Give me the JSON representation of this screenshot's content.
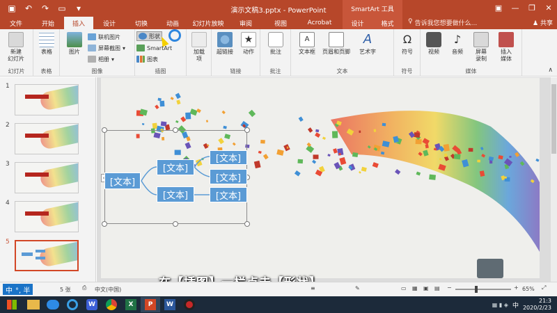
{
  "window": {
    "title": "演示文稿3.pptx - PowerPoint",
    "context_title": "SmartArt 工具",
    "controls": [
      "▣",
      "—",
      "❐",
      "✕"
    ]
  },
  "tabs": [
    {
      "label": "文件",
      "w": 46
    },
    {
      "label": "开始",
      "w": 46
    },
    {
      "label": "插入",
      "w": 42,
      "active": true
    },
    {
      "label": "设计",
      "w": 46
    },
    {
      "label": "切换",
      "w": 46
    },
    {
      "label": "动画",
      "w": 44
    },
    {
      "label": "幻灯片放映",
      "w": 58
    },
    {
      "label": "审阅",
      "w": 50
    },
    {
      "label": "视图",
      "w": 50
    },
    {
      "label": "Acrobat",
      "w": 62
    }
  ],
  "context_tabs": [
    "设计",
    "格式"
  ],
  "tell_me": "告诉我您想要做什么...",
  "share": "共享",
  "ribbon": {
    "groups": {
      "slides": "幻灯片",
      "tables": "表格",
      "images": "图像",
      "illustrations": "插图",
      "links": "链接",
      "comments": "批注",
      "text": "文本",
      "symbols": "符号",
      "media": "媒体"
    },
    "new_slide": "新建\n幻灯片",
    "table": "表格",
    "pictures": "图片",
    "online_pictures": "联机图片",
    "screenshot": "屏幕截图",
    "album": "相册",
    "shapes": "形状",
    "smartart": "SmartArt",
    "chart": "图表",
    "addins": "加载\n项",
    "hyperlink": "超链接",
    "action": "动作",
    "comment": "批注",
    "textbox": "文本框",
    "header_footer": "页眉和页脚",
    "wordart": "艺术字",
    "symbol": "符号",
    "video": "视频",
    "audio": "音频",
    "screen_recording": "屏幕\n录制",
    "insert_media": "插入\n媒体"
  },
  "thumbnails": [
    {
      "num": "1"
    },
    {
      "num": "2"
    },
    {
      "num": "3"
    },
    {
      "num": "4"
    },
    {
      "num": "5",
      "selected": true
    }
  ],
  "smartart": {
    "left": "[文本]",
    "mid_top": "[文本]",
    "mid_bottom": "[文本]",
    "r1": "[文本]",
    "r2": "[文本]",
    "r3": "[文本]"
  },
  "caption": "在【插图】一栏点击【形状】",
  "status": {
    "slide_count": "5 张",
    "language": "中文(中国)",
    "zoom": "65%",
    "ime": "中",
    "ime_tail": "°, 半"
  },
  "taskbar": {
    "date": "2020/2/23",
    "time": "21:3",
    "ime": "中"
  }
}
